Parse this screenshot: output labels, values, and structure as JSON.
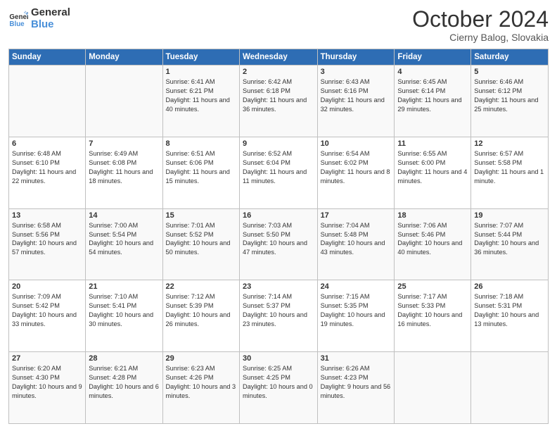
{
  "header": {
    "logo_line1": "General",
    "logo_line2": "Blue",
    "title": "October 2024",
    "subtitle": "Cierny Balog, Slovakia"
  },
  "days_of_week": [
    "Sunday",
    "Monday",
    "Tuesday",
    "Wednesday",
    "Thursday",
    "Friday",
    "Saturday"
  ],
  "weeks": [
    [
      {
        "day": "",
        "info": ""
      },
      {
        "day": "",
        "info": ""
      },
      {
        "day": "1",
        "info": "Sunrise: 6:41 AM\nSunset: 6:21 PM\nDaylight: 11 hours and 40 minutes."
      },
      {
        "day": "2",
        "info": "Sunrise: 6:42 AM\nSunset: 6:18 PM\nDaylight: 11 hours and 36 minutes."
      },
      {
        "day": "3",
        "info": "Sunrise: 6:43 AM\nSunset: 6:16 PM\nDaylight: 11 hours and 32 minutes."
      },
      {
        "day": "4",
        "info": "Sunrise: 6:45 AM\nSunset: 6:14 PM\nDaylight: 11 hours and 29 minutes."
      },
      {
        "day": "5",
        "info": "Sunrise: 6:46 AM\nSunset: 6:12 PM\nDaylight: 11 hours and 25 minutes."
      }
    ],
    [
      {
        "day": "6",
        "info": "Sunrise: 6:48 AM\nSunset: 6:10 PM\nDaylight: 11 hours and 22 minutes."
      },
      {
        "day": "7",
        "info": "Sunrise: 6:49 AM\nSunset: 6:08 PM\nDaylight: 11 hours and 18 minutes."
      },
      {
        "day": "8",
        "info": "Sunrise: 6:51 AM\nSunset: 6:06 PM\nDaylight: 11 hours and 15 minutes."
      },
      {
        "day": "9",
        "info": "Sunrise: 6:52 AM\nSunset: 6:04 PM\nDaylight: 11 hours and 11 minutes."
      },
      {
        "day": "10",
        "info": "Sunrise: 6:54 AM\nSunset: 6:02 PM\nDaylight: 11 hours and 8 minutes."
      },
      {
        "day": "11",
        "info": "Sunrise: 6:55 AM\nSunset: 6:00 PM\nDaylight: 11 hours and 4 minutes."
      },
      {
        "day": "12",
        "info": "Sunrise: 6:57 AM\nSunset: 5:58 PM\nDaylight: 11 hours and 1 minute."
      }
    ],
    [
      {
        "day": "13",
        "info": "Sunrise: 6:58 AM\nSunset: 5:56 PM\nDaylight: 10 hours and 57 minutes."
      },
      {
        "day": "14",
        "info": "Sunrise: 7:00 AM\nSunset: 5:54 PM\nDaylight: 10 hours and 54 minutes."
      },
      {
        "day": "15",
        "info": "Sunrise: 7:01 AM\nSunset: 5:52 PM\nDaylight: 10 hours and 50 minutes."
      },
      {
        "day": "16",
        "info": "Sunrise: 7:03 AM\nSunset: 5:50 PM\nDaylight: 10 hours and 47 minutes."
      },
      {
        "day": "17",
        "info": "Sunrise: 7:04 AM\nSunset: 5:48 PM\nDaylight: 10 hours and 43 minutes."
      },
      {
        "day": "18",
        "info": "Sunrise: 7:06 AM\nSunset: 5:46 PM\nDaylight: 10 hours and 40 minutes."
      },
      {
        "day": "19",
        "info": "Sunrise: 7:07 AM\nSunset: 5:44 PM\nDaylight: 10 hours and 36 minutes."
      }
    ],
    [
      {
        "day": "20",
        "info": "Sunrise: 7:09 AM\nSunset: 5:42 PM\nDaylight: 10 hours and 33 minutes."
      },
      {
        "day": "21",
        "info": "Sunrise: 7:10 AM\nSunset: 5:41 PM\nDaylight: 10 hours and 30 minutes."
      },
      {
        "day": "22",
        "info": "Sunrise: 7:12 AM\nSunset: 5:39 PM\nDaylight: 10 hours and 26 minutes."
      },
      {
        "day": "23",
        "info": "Sunrise: 7:14 AM\nSunset: 5:37 PM\nDaylight: 10 hours and 23 minutes."
      },
      {
        "day": "24",
        "info": "Sunrise: 7:15 AM\nSunset: 5:35 PM\nDaylight: 10 hours and 19 minutes."
      },
      {
        "day": "25",
        "info": "Sunrise: 7:17 AM\nSunset: 5:33 PM\nDaylight: 10 hours and 16 minutes."
      },
      {
        "day": "26",
        "info": "Sunrise: 7:18 AM\nSunset: 5:31 PM\nDaylight: 10 hours and 13 minutes."
      }
    ],
    [
      {
        "day": "27",
        "info": "Sunrise: 6:20 AM\nSunset: 4:30 PM\nDaylight: 10 hours and 9 minutes."
      },
      {
        "day": "28",
        "info": "Sunrise: 6:21 AM\nSunset: 4:28 PM\nDaylight: 10 hours and 6 minutes."
      },
      {
        "day": "29",
        "info": "Sunrise: 6:23 AM\nSunset: 4:26 PM\nDaylight: 10 hours and 3 minutes."
      },
      {
        "day": "30",
        "info": "Sunrise: 6:25 AM\nSunset: 4:25 PM\nDaylight: 10 hours and 0 minutes."
      },
      {
        "day": "31",
        "info": "Sunrise: 6:26 AM\nSunset: 4:23 PM\nDaylight: 9 hours and 56 minutes."
      },
      {
        "day": "",
        "info": ""
      },
      {
        "day": "",
        "info": ""
      }
    ]
  ]
}
